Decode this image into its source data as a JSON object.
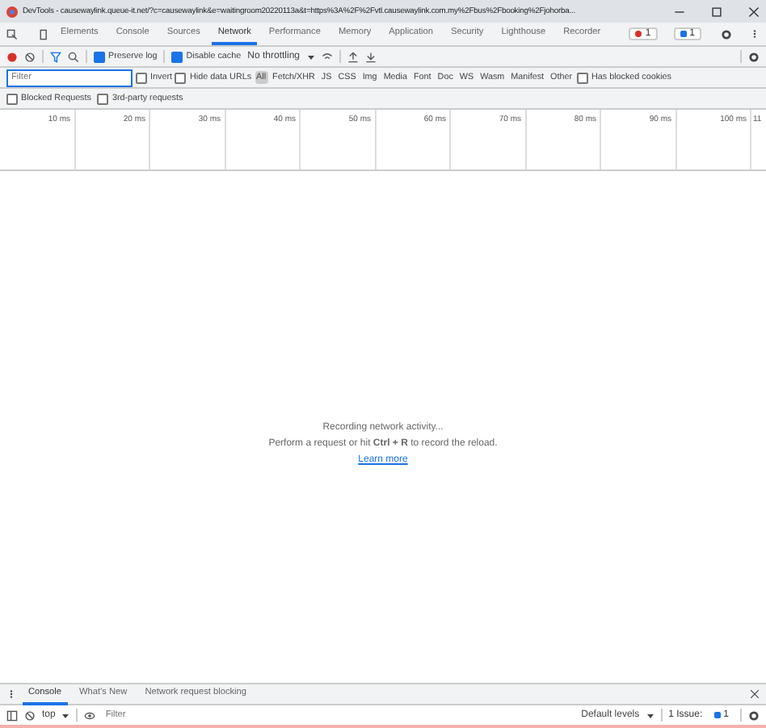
{
  "window": {
    "title": "DevTools - causewaylink.queue-it.net/?c=causewaylink&e=waitingroom20220113a&t=https%3A%2F%2Fvtl.causewaylink.com.my%2Fbus%2Fbooking%2Fjohorba..."
  },
  "tabs": [
    {
      "label": "Elements",
      "selected": false
    },
    {
      "label": "Console",
      "selected": false
    },
    {
      "label": "Sources",
      "selected": false
    },
    {
      "label": "Network",
      "selected": true
    },
    {
      "label": "Performance",
      "selected": false
    },
    {
      "label": "Memory",
      "selected": false
    },
    {
      "label": "Application",
      "selected": false
    },
    {
      "label": "Security",
      "selected": false
    },
    {
      "label": "Lighthouse",
      "selected": false
    },
    {
      "label": "Recorder",
      "selected": false
    }
  ],
  "badges": {
    "errors": "1",
    "messages": "1"
  },
  "toolbar": {
    "preserve_log": {
      "label": "Preserve log",
      "checked": true
    },
    "disable_cache": {
      "label": "Disable cache",
      "checked": true
    },
    "throttling": "No throttling"
  },
  "filter": {
    "placeholder": "Filter",
    "invert": {
      "label": "Invert",
      "checked": false
    },
    "hide_data_urls": {
      "label": "Hide data URLs",
      "checked": false
    },
    "types": [
      {
        "label": "All",
        "selected": true
      },
      {
        "label": "Fetch/XHR",
        "selected": false
      },
      {
        "label": "JS",
        "selected": false
      },
      {
        "label": "CSS",
        "selected": false
      },
      {
        "label": "Img",
        "selected": false
      },
      {
        "label": "Media",
        "selected": false
      },
      {
        "label": "Font",
        "selected": false
      },
      {
        "label": "Doc",
        "selected": false
      },
      {
        "label": "WS",
        "selected": false
      },
      {
        "label": "Wasm",
        "selected": false
      },
      {
        "label": "Manifest",
        "selected": false
      },
      {
        "label": "Other",
        "selected": false
      }
    ],
    "has_blocked_cookies": {
      "label": "Has blocked cookies",
      "checked": false
    }
  },
  "options": [
    {
      "label": "Blocked Requests",
      "checked": false
    },
    {
      "label": "3rd-party requests",
      "checked": false
    }
  ],
  "timeline": {
    "ticks": [
      "10 ms",
      "20 ms",
      "30 ms",
      "40 ms",
      "50 ms",
      "60 ms",
      "70 ms",
      "80 ms",
      "90 ms",
      "100 ms",
      "11"
    ]
  },
  "empty": {
    "title": "Recording network activity...",
    "hint": "Perform a request or hit **Ctrl + R** to record the reload.",
    "link": "Learn more"
  },
  "drawer": {
    "tabs": [
      {
        "label": "Console",
        "selected": true
      },
      {
        "label": "What's New",
        "selected": false
      },
      {
        "label": "Network request blocking",
        "selected": false
      }
    ],
    "context": "top",
    "placeholder": "Filter",
    "levels": "Default levels",
    "issues": "1 Issue:",
    "issue_count": "1"
  }
}
